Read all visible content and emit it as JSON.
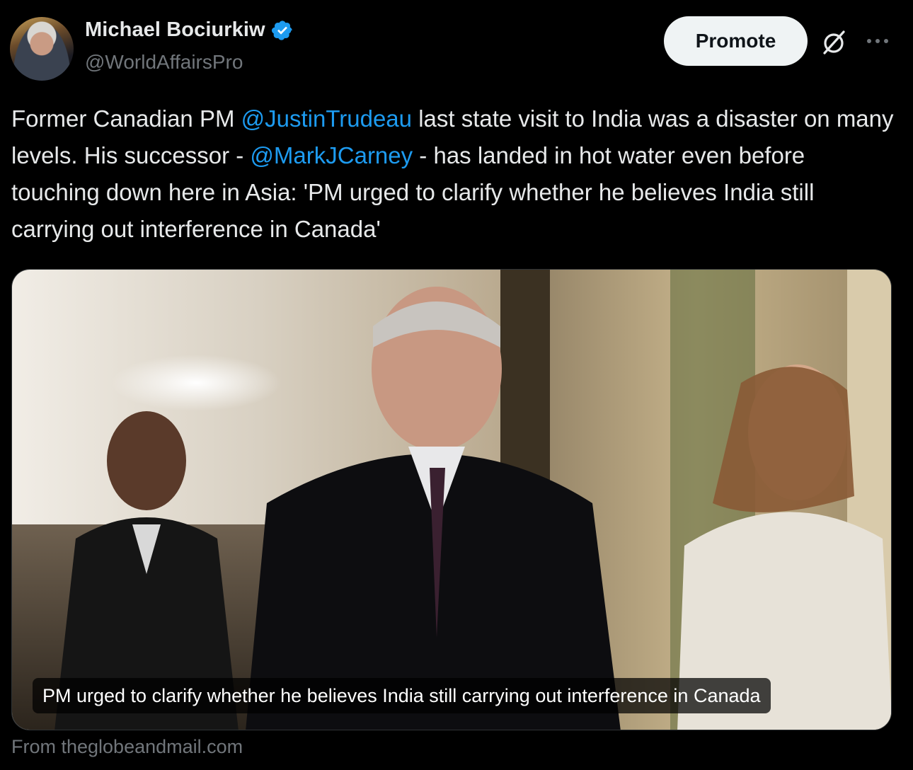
{
  "author": {
    "display_name": "Michael Bociurkiw",
    "handle": "@WorldAffairsPro",
    "verified": true,
    "verified_color": "#1d9bf0"
  },
  "actions": {
    "promote_label": "Promote",
    "grok_icon": "slashed-circle-icon",
    "more_icon": "ellipsis-icon"
  },
  "tweet": {
    "segments": [
      {
        "text": "Former Canadian PM ",
        "mention": false
      },
      {
        "text": "@JustinTrudeau",
        "mention": true
      },
      {
        "text": " last state visit to India was a disaster on many levels. His successor - ",
        "mention": false
      },
      {
        "text": "@MarkJCarney",
        "mention": true
      },
      {
        "text": " - has landed in hot water even before touching down here in Asia: 'PM urged to clarify whether he believes India still carrying out interference in Canada'",
        "mention": false
      }
    ]
  },
  "card": {
    "caption": "PM urged to clarify whether he believes India still carrying out interference in Canada",
    "source": "From theglobeandmail.com"
  },
  "colors": {
    "background": "#000000",
    "text": "#e7e9ea",
    "secondary": "#71767b",
    "link": "#1d9bf0"
  }
}
